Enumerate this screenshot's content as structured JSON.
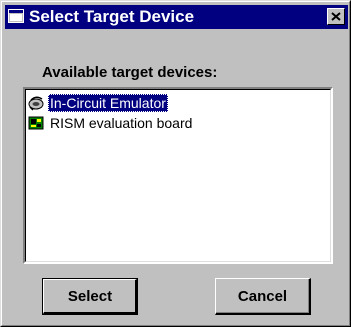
{
  "window": {
    "title": "Select Target Device",
    "icon": "window-icon",
    "close_icon": "close-icon"
  },
  "prompt": "Available target devices:",
  "devices": [
    {
      "label": "In-Circuit Emulator",
      "icon": "emulator-icon",
      "selected": true
    },
    {
      "label": "RISM evaluation board",
      "icon": "board-chip-icon",
      "selected": false
    }
  ],
  "buttons": {
    "select_label": "Select",
    "cancel_label": "Cancel"
  },
  "colors": {
    "titlebar": "#000080",
    "face": "#c0c0c0",
    "selection": "#000080"
  }
}
